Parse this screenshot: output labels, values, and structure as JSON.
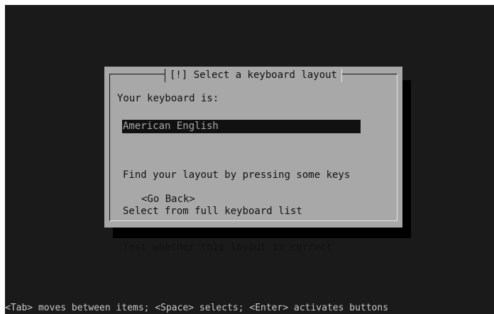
{
  "dialog": {
    "title": "[!] Select a keyboard layout",
    "prompt": "Your keyboard is:",
    "selected_option": "American English",
    "options": [
      "Find your layout by pressing some keys",
      "Select from full keyboard list",
      "Test whether this layout is correct"
    ],
    "go_back_label": "<Go Back>"
  },
  "status_bar": {
    "hint": "<Tab> moves between items; <Space> selects; <Enter> activates buttons"
  },
  "colors": {
    "screen_background": "#1a1a1a",
    "dialog_background": "#a8a8a8",
    "selection_background": "#111111",
    "selection_text": "#a8a8a8"
  }
}
